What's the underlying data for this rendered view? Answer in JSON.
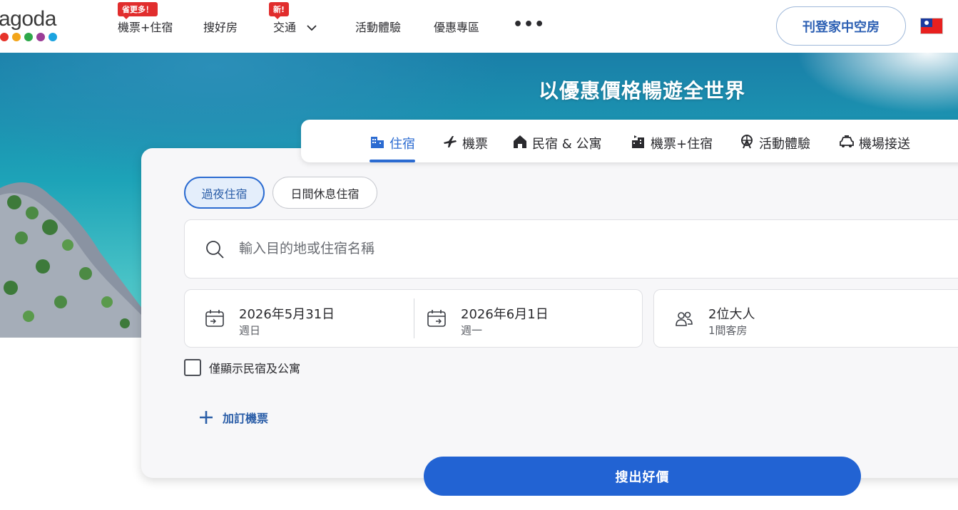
{
  "header": {
    "logo_text": "agoda",
    "logo_dot_colors": [
      "#e6332a",
      "#f3a51a",
      "#2ea84a",
      "#9b3d97",
      "#1ba3e0"
    ],
    "nav": [
      {
        "label": "機票+住宿",
        "badge": "省更多！"
      },
      {
        "label": "搜好房",
        "badge": ""
      },
      {
        "label": "交通",
        "badge": "新!"
      },
      {
        "label": "活動體驗",
        "badge": ""
      },
      {
        "label": "優惠專區",
        "badge": ""
      }
    ],
    "more_label": "•••",
    "list_property_label": "刊登家中空房",
    "flag_icon": "taiwan-flag-icon"
  },
  "hero": {
    "title": "以優惠價格暢遊全世界"
  },
  "tabs": [
    {
      "label": "住宿",
      "icon": "hotel-building-icon",
      "active": true
    },
    {
      "label": "機票",
      "icon": "airplane-icon",
      "active": false
    },
    {
      "label": "民宿 & 公寓",
      "icon": "house-icon",
      "active": false
    },
    {
      "label": "機票+住宿",
      "icon": "flight-hotel-icon",
      "active": false
    },
    {
      "label": "活動體驗",
      "icon": "ferris-wheel-icon",
      "active": false
    },
    {
      "label": "機場接送",
      "icon": "car-icon",
      "active": false
    }
  ],
  "search": {
    "stay_types": [
      "過夜住宿",
      "日間休息住宿"
    ],
    "destination_placeholder": "輸入目的地或住宿名稱",
    "checkin": {
      "date": "2026年5月31日",
      "weekday": "週日"
    },
    "checkout": {
      "date": "2026年6月1日",
      "weekday": "週一"
    },
    "guests": {
      "main": "2位大人",
      "sub": "1間客房"
    },
    "homes_only_label": "僅顯示民宿及公寓",
    "add_flight_label": "加訂機票",
    "submit_label": "搜出好價"
  },
  "colors": {
    "accent": "#2263d3",
    "badge_red": "#e12d2d"
  }
}
